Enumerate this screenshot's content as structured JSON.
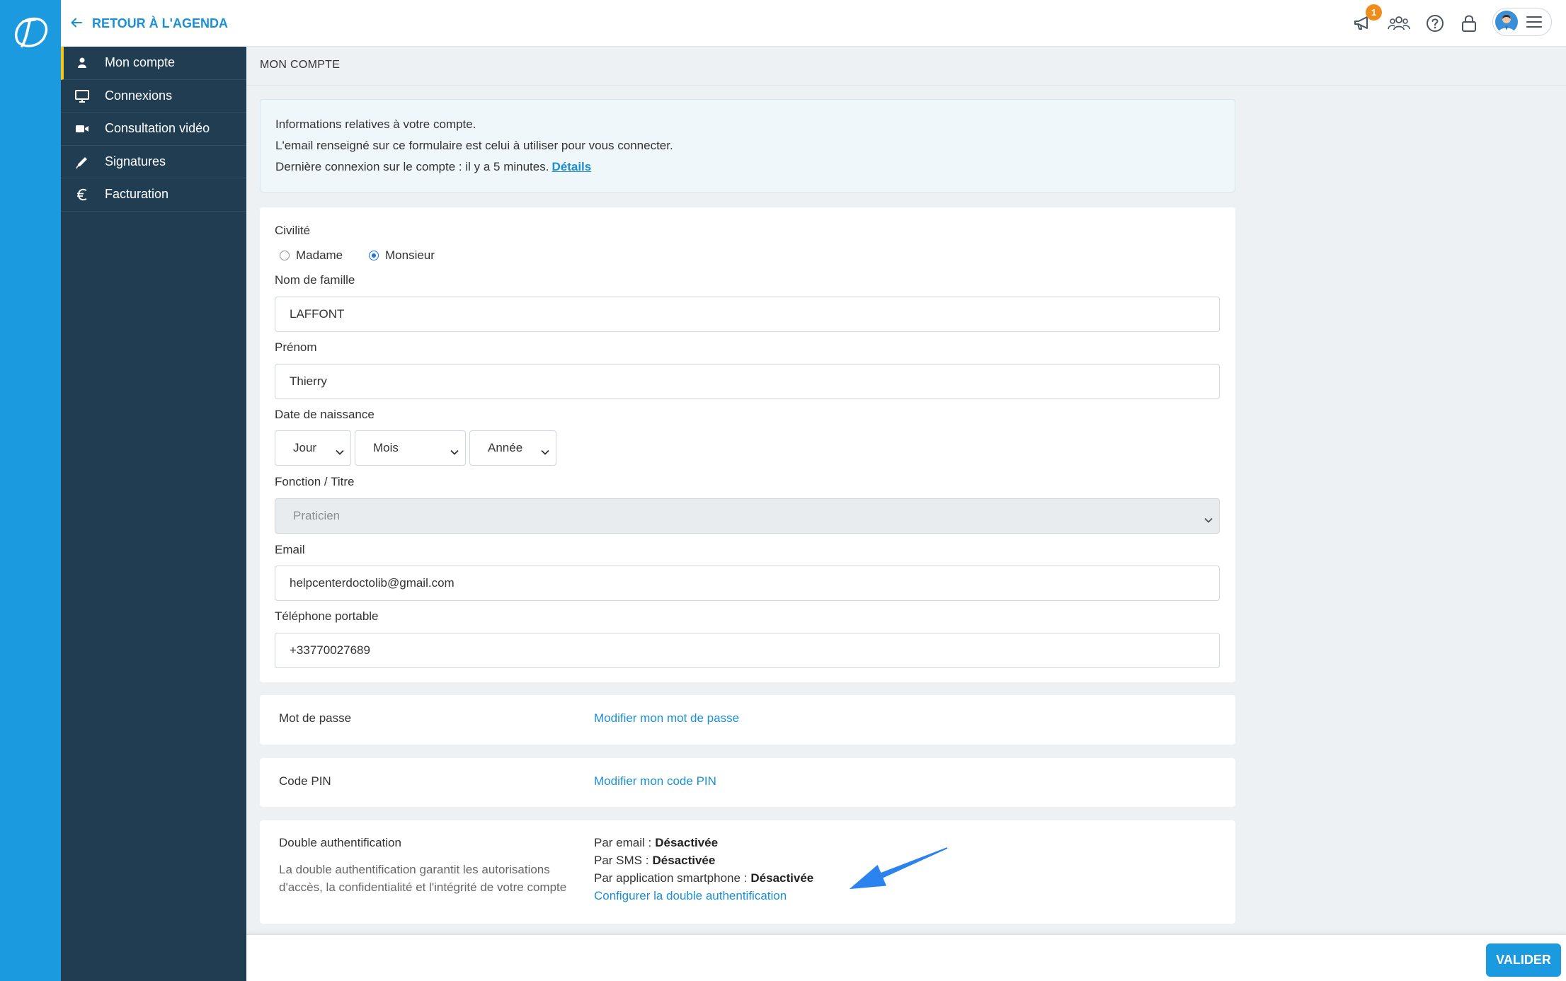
{
  "app": {
    "back_label": "RETOUR À L'AGENDA",
    "notification_count": "1"
  },
  "sidebar": {
    "items": [
      {
        "label": "Mon compte",
        "icon": "user-icon",
        "active": true
      },
      {
        "label": "Connexions",
        "icon": "monitor-icon",
        "active": false
      },
      {
        "label": "Consultation vidéo",
        "icon": "video-camera-icon",
        "active": false
      },
      {
        "label": "Signatures",
        "icon": "pen-icon",
        "active": false
      },
      {
        "label": "Facturation",
        "icon": "euro-icon",
        "active": false
      }
    ]
  },
  "page": {
    "title": "MON COMPTE"
  },
  "info": {
    "line1": "Informations relatives à votre compte.",
    "line2": "L'email renseigné sur ce formulaire est celui à utiliser pour vous connecter.",
    "line3": "Dernière connexion sur le compte : il y a 5 minutes.",
    "details_link": "Détails"
  },
  "form": {
    "civility": {
      "label": "Civilité",
      "options": [
        "Madame",
        "Monsieur"
      ],
      "selected": "Monsieur"
    },
    "last_name": {
      "label": "Nom de famille",
      "value": "LAFFONT"
    },
    "first_name": {
      "label": "Prénom",
      "value": "Thierry"
    },
    "birth_date": {
      "label": "Date de naissance",
      "day": "Jour",
      "month": "Mois",
      "year": "Année"
    },
    "function": {
      "label": "Fonction / Titre",
      "value": "Praticien",
      "disabled": true
    },
    "email": {
      "label": "Email",
      "value": "helpcenterdoctolib@gmail.com"
    },
    "mobile_phone": {
      "label": "Téléphone portable",
      "value": "+33770027689"
    }
  },
  "password": {
    "label": "Mot de passe",
    "link": "Modifier mon mot de passe"
  },
  "pin": {
    "label": "Code PIN",
    "link": "Modifier mon code PIN"
  },
  "two_factor": {
    "label": "Double authentification",
    "description_line1": "La double authentification garantit les autorisations",
    "description_line2": "d'accès, la confidentialité et l'intégrité de votre compte",
    "methods": [
      {
        "label": "Par email :",
        "status": "Désactivée"
      },
      {
        "label": "Par SMS :",
        "status": "Désactivée"
      },
      {
        "label": "Par application smartphone :",
        "status": "Désactivée"
      }
    ],
    "configure_link": "Configurer la double authentification"
  },
  "footer": {
    "submit_label": "VALIDER"
  },
  "colors": {
    "brand_blue": "#1c9ae0",
    "link_blue": "#1a8fd6",
    "sidebar_bg": "#203d52",
    "active_indicator": "#f5c518",
    "badge": "#f08c1a",
    "annotation_arrow": "#2a83ee"
  }
}
